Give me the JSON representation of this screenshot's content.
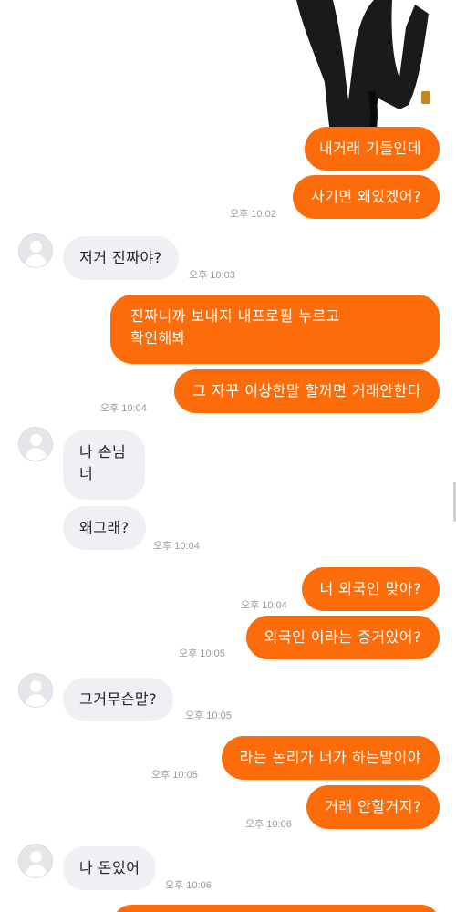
{
  "messages": [
    {
      "id": "m1",
      "text": "내거래 기들인데",
      "time": ""
    },
    {
      "id": "m2",
      "text": "사기면 왜있겠어?",
      "time": "오후 10:02"
    },
    {
      "id": "m3",
      "text": "저거 진짜야?",
      "time": "오후 10:03"
    },
    {
      "id": "m4",
      "text": "진짜니까 보내지 내프로필 누르고\n확인해봐",
      "time": ""
    },
    {
      "id": "m5",
      "text": "그 자꾸 이상한말 할꺼면 거래안한다",
      "time": "오후 10:04"
    },
    {
      "id": "m6",
      "text": "나 손님\n너",
      "time": ""
    },
    {
      "id": "m7",
      "text": "왜그래?",
      "time": "오후 10:04"
    },
    {
      "id": "m8",
      "text": "너 외국인 맞아?",
      "time": "오후 10:04"
    },
    {
      "id": "m9",
      "text": "외국인 이라는 증거있어?",
      "time": "오후 10:05"
    },
    {
      "id": "m10",
      "text": "그거무슨말?",
      "time": "오후 10:05"
    },
    {
      "id": "m11",
      "text": "라는 논리가 너가 하는말이야",
      "time": "오후 10:05"
    },
    {
      "id": "m12",
      "text": "거래 안할거지?",
      "time": "오후 10:06"
    },
    {
      "id": "m13",
      "text": "나 돈있어",
      "time": "오후 10:06"
    }
  ],
  "colors": {
    "outgoing": "#fc6c0a",
    "incoming": "#eff0f4",
    "timestamp": "#9a9a9a"
  },
  "icons": [
    "default-avatar-icon"
  ]
}
